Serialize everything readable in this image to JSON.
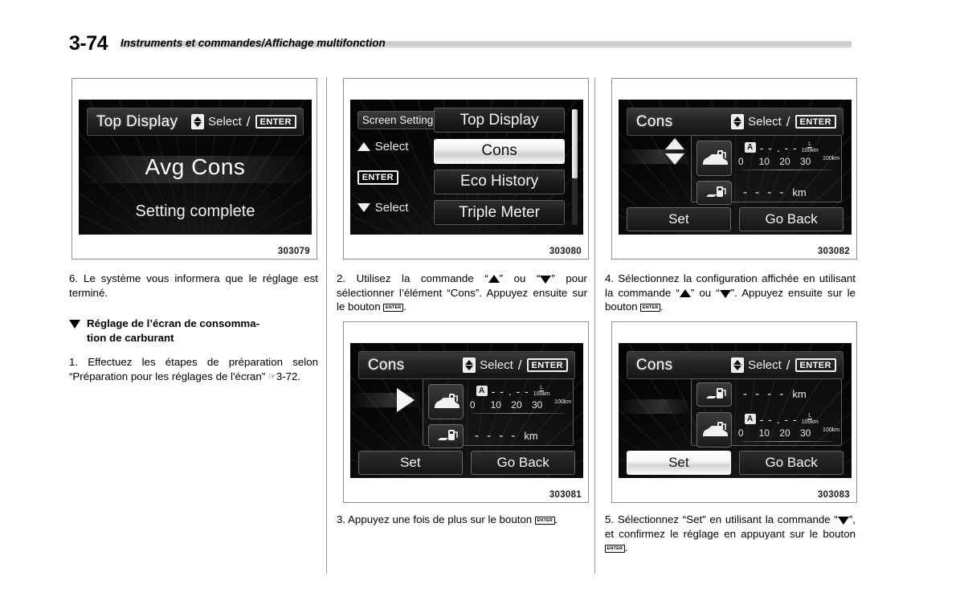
{
  "header": {
    "page_number": "3-74",
    "title": "Instruments et commandes/Affichage multifonction"
  },
  "figures": {
    "fig1": {
      "number": "303079",
      "screen": {
        "title": "Top Display",
        "select_label": "Select",
        "enter_label": "ENTER",
        "main_text": "Avg Cons",
        "status_text": "Setting complete"
      }
    },
    "fig2": {
      "number": "303080",
      "screen": {
        "left_chip": "Screen Setting",
        "select_up_label": "Select",
        "enter_label": "ENTER",
        "select_down_label": "Select",
        "menu_items": [
          {
            "label": "Top Display",
            "selected": false
          },
          {
            "label": "Cons",
            "selected": true
          },
          {
            "label": "Eco History",
            "selected": false
          },
          {
            "label": "Triple Meter",
            "selected": false
          }
        ]
      }
    },
    "fig3": {
      "number": "303082",
      "screen": {
        "title": "Cons",
        "select_label": "Select",
        "enter_label": "ENTER",
        "cursor": "up-down-arrows",
        "rows": [
          {
            "icon": "car-fuel-pump-icon",
            "badge": "A",
            "value": "- - . - -",
            "unit_top": "L",
            "unit_bottom": "100km",
            "scale_ticks": [
              "0",
              "10",
              "20",
              "30"
            ],
            "scale_unit": "100km"
          },
          {
            "icon": "range-fuel-pump-icon",
            "value": "- - - -",
            "unit": "km"
          }
        ],
        "buttons": [
          {
            "label": "Set",
            "active": false
          },
          {
            "label": "Go Back",
            "active": false
          }
        ]
      }
    },
    "fig4": {
      "number": "303081",
      "screen": {
        "title": "Cons",
        "select_label": "Select",
        "enter_label": "ENTER",
        "cursor": "right-arrow",
        "rows": [
          {
            "icon": "car-fuel-pump-icon",
            "badge": "A",
            "value": "- - . - -",
            "unit_top": "L",
            "unit_bottom": "100km",
            "scale_ticks": [
              "0",
              "10",
              "20",
              "30"
            ],
            "scale_unit": "100km"
          },
          {
            "icon": "range-fuel-pump-icon",
            "value": "- - - -",
            "unit": "km"
          }
        ],
        "buttons": [
          {
            "label": "Set",
            "active": false
          },
          {
            "label": "Go Back",
            "active": false
          }
        ]
      }
    },
    "fig5": {
      "number": "303083",
      "screen": {
        "title": "Cons",
        "select_label": "Select",
        "enter_label": "ENTER",
        "cursor": "none",
        "rows": [
          {
            "icon": "range-fuel-pump-icon",
            "value": "- - - -",
            "unit": "km"
          },
          {
            "icon": "car-fuel-pump-icon",
            "badge": "A",
            "value": "- - . - -",
            "unit_top": "L",
            "unit_bottom": "100km",
            "scale_ticks": [
              "0",
              "10",
              "20",
              "30"
            ],
            "scale_unit": "100km"
          }
        ],
        "buttons": [
          {
            "label": "Set",
            "active": true
          },
          {
            "label": "Go Back",
            "active": false
          }
        ]
      }
    }
  },
  "body": {
    "step6": "6. Le système vous informera que le réglage est terminé.",
    "section_heading_line1": "Réglage de l’écran de consomma-",
    "section_heading_line2": "tion de carburant",
    "step1_a": "1. Effectuez les étapes de préparation selon “Préparation pour les réglages de l'écran” ",
    "step1_ref": "3-72.",
    "step2_a": "2. Utilisez la commande “",
    "step2_b": "” ou “",
    "step2_c": "” pour sélectionner l’élément “Cons”. Appuyez ensuite sur le bouton ",
    "step2_enter": "ENTER",
    "step2_d": ".",
    "step3_a": "3.   Appuyez une fois de plus sur le bouton ",
    "step3_enter": "ENTER",
    "step3_b": ".",
    "step4_a": "4. Sélectionnez la configuration affichée en utilisant la commande “",
    "step4_b": "” ou “",
    "step4_c": "”. Appuyez ensuite sur le bouton ",
    "step4_enter": "ENTER",
    "step4_d": ".",
    "step5_a": "5. Sélectionnez “Set” en utilisant la commande “",
    "step5_b": "”, et confirmez le réglage en appuyant sur le bouton ",
    "step5_enter": "ENTER",
    "step5_c": "."
  }
}
